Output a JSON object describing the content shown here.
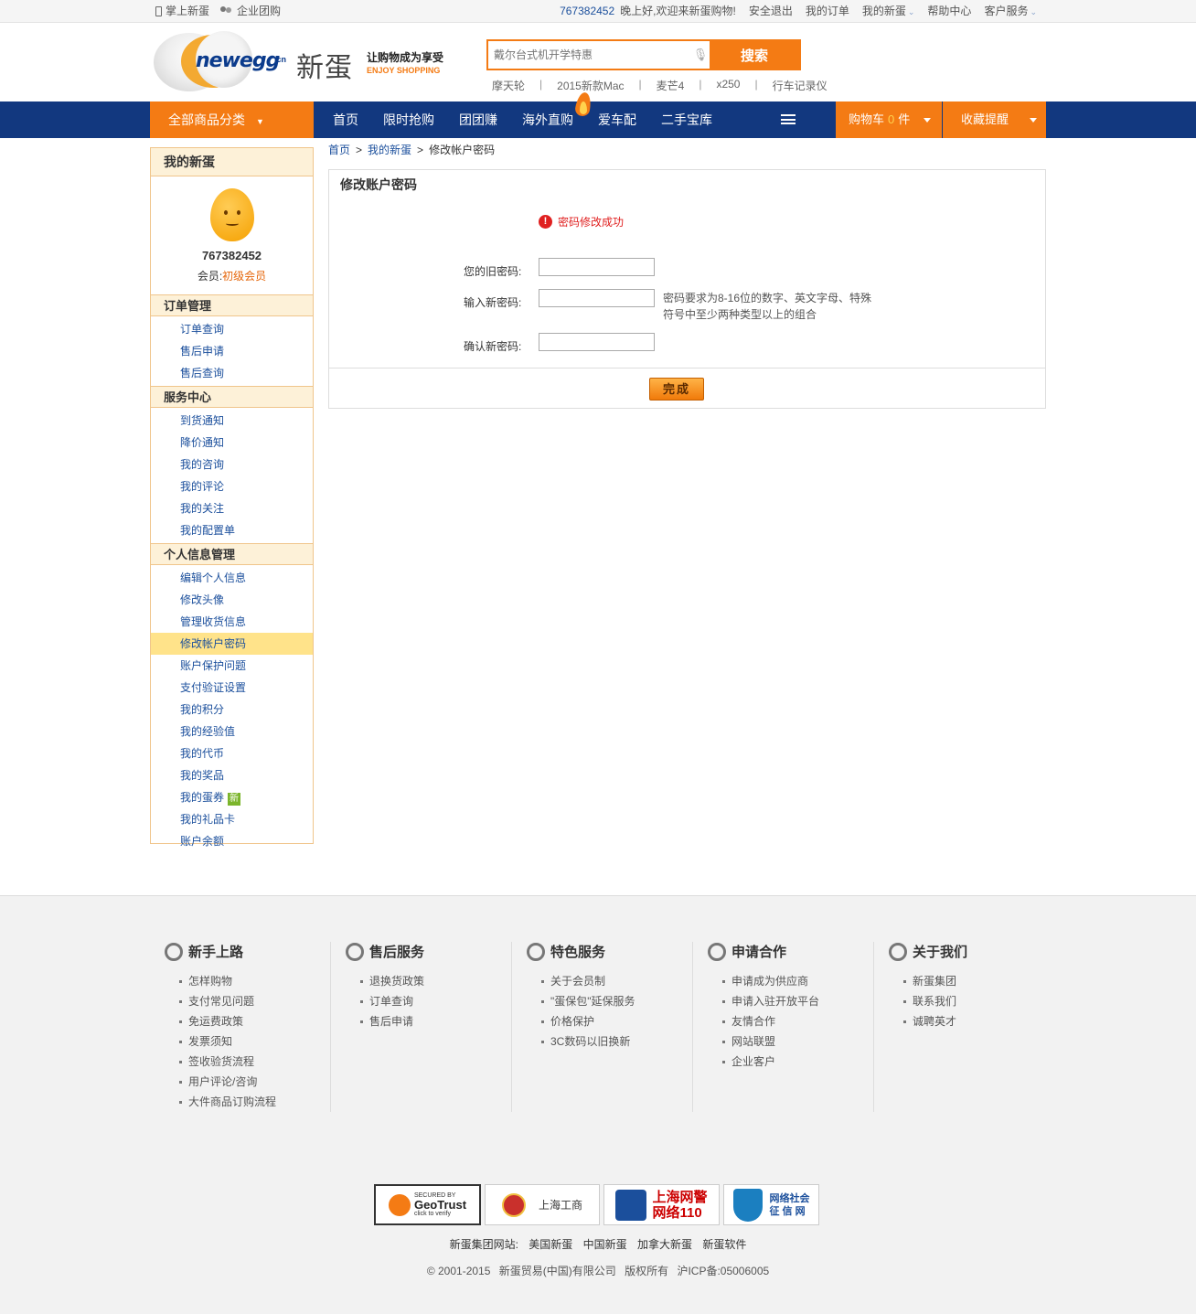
{
  "topbar": {
    "mobile": "掌上新蛋",
    "group_buy": "企业团购",
    "user_id": "767382452",
    "greeting": "晚上好,欢迎来新蛋购物!",
    "logout": "安全退出",
    "my_orders": "我的订单",
    "my_newegg": "我的新蛋",
    "help": "帮助中心",
    "service": "客户服务"
  },
  "header": {
    "logo_text": "newegg",
    "logo_cn": ".cn",
    "brand_cn": "新蛋",
    "slogan": "让购物成为享受",
    "slogan_en": "ENJOY SHOPPING",
    "search_placeholder": "戴尔台式机开学特惠",
    "search_button": "搜索",
    "hotwords": [
      "摩天轮",
      "2015新款Mac",
      "麦芒4",
      "x250",
      "行车记录仪"
    ]
  },
  "nav": {
    "all_categories": "全部商品分类",
    "links": [
      "首页",
      "限时抢购",
      "团团赚",
      "海外直购",
      "爱车配",
      "二手宝库"
    ],
    "cart_label": "购物车",
    "cart_count": "0",
    "cart_unit": "件",
    "favorites": "收藏提醒"
  },
  "sidebar": {
    "title": "我的新蛋",
    "uid": "767382452",
    "member_label": "会员:",
    "member_level": "初级会员",
    "sections": [
      {
        "title": "订单管理",
        "items": [
          "订单查询",
          "售后申请",
          "售后查询"
        ]
      },
      {
        "title": "服务中心",
        "items": [
          "到货通知",
          "降价通知",
          "我的咨询",
          "我的评论",
          "我的关注",
          "我的配置单"
        ]
      },
      {
        "title": "个人信息管理",
        "items": [
          "编辑个人信息",
          "修改头像",
          "管理收货信息",
          "修改帐户密码",
          "账户保护问题",
          "支付验证设置",
          "我的积分",
          "我的经验值",
          "我的代币",
          "我的奖品",
          "我的蛋券",
          "我的礼品卡",
          "账户余额"
        ]
      }
    ],
    "new_badge": "新"
  },
  "breadcrumb": {
    "home": "首页",
    "sep": ">",
    "mine": "我的新蛋",
    "current": "修改帐户密码"
  },
  "form": {
    "title": "修改账户密码",
    "success_message": "密码修改成功",
    "old_label": "您的旧密码:",
    "new_label": "输入新密码:",
    "confirm_label": "确认新密码:",
    "hint": "密码要求为8-16位的数字、英文字母、特殊符号中至少两种类型以上的组合",
    "submit": "完成"
  },
  "footer": {
    "columns": [
      {
        "title": "新手上路",
        "items": [
          "怎样购物",
          "支付常见问题",
          "免运费政策",
          "发票须知",
          "签收验货流程",
          "用户评论/咨询",
          "大件商品订购流程"
        ]
      },
      {
        "title": "售后服务",
        "items": [
          "退换货政策",
          "订单查询",
          "售后申请"
        ]
      },
      {
        "title": "特色服务",
        "items": [
          "关于会员制",
          "\"蛋保包\"延保服务",
          "价格保护",
          "3C数码以旧换新"
        ]
      },
      {
        "title": "申请合作",
        "items": [
          "申请成为供应商",
          "申请入驻开放平台",
          "友情合作",
          "网站联盟",
          "企业客户"
        ]
      },
      {
        "title": "关于我们",
        "items": [
          "新蛋集团",
          "联系我们",
          "诚聘英才"
        ]
      }
    ],
    "badges": {
      "geotrust_top": "SECURED BY",
      "geotrust_name": "GeoTrust",
      "geotrust_sub": "click to verify",
      "gongshang": "上海工商",
      "police_line1": "上海网警",
      "police_line2": "网络110",
      "credit_line1": "网络社会",
      "credit_line2": "征 信 网"
    },
    "group_sites_label": "新蛋集团网站:",
    "group_sites": [
      "美国新蛋",
      "中国新蛋",
      "加拿大新蛋",
      "新蛋软件"
    ],
    "copyright": [
      "© 2001-2015",
      "新蛋贸易(中国)有限公司",
      "版权所有",
      "沪ICP备:05006005"
    ]
  }
}
